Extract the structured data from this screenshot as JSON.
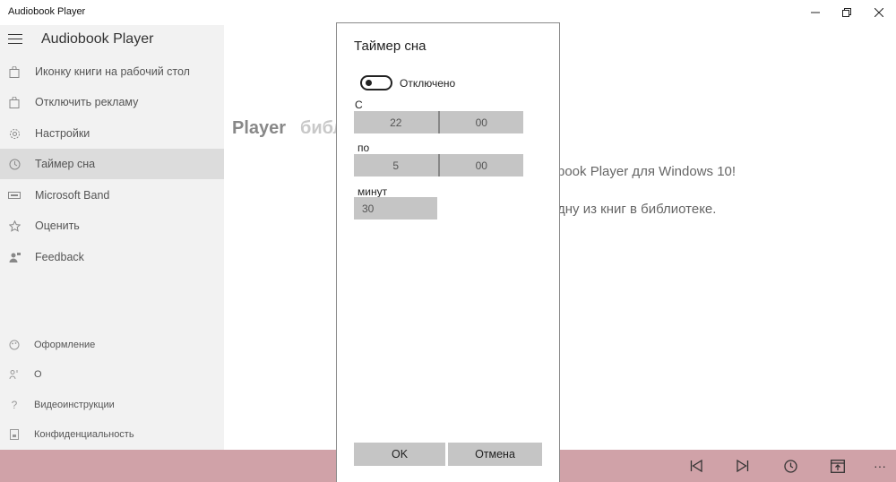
{
  "window": {
    "title": "Audiobook Player",
    "controls": [
      "minimize-icon",
      "restore-icon",
      "close-icon"
    ]
  },
  "sidebar": {
    "title": "Audiobook Player",
    "items": [
      {
        "label": "Иконку книги на рабочий стол",
        "icon": "shopping-bag-icon"
      },
      {
        "label": "Отключить рекламу",
        "icon": "shopping-bag-icon"
      },
      {
        "label": "Настройки",
        "icon": "gear-icon"
      },
      {
        "label": "Таймер сна",
        "icon": "clock-icon",
        "selected": true
      },
      {
        "label": "Microsoft Band",
        "icon": "band-icon"
      },
      {
        "label": "Оценить",
        "icon": "star-icon"
      },
      {
        "label": "Feedback",
        "icon": "feedback-icon"
      }
    ],
    "bottom_items": [
      {
        "label": "Оформление",
        "icon": "palette-icon"
      },
      {
        "label": "О",
        "icon": "about-icon"
      },
      {
        "label": "Видеоинструкции",
        "icon": "help-icon"
      },
      {
        "label": "Конфиденциальность",
        "icon": "privacy-icon"
      }
    ]
  },
  "main": {
    "tabs": [
      "Player",
      "библ"
    ],
    "welcome_line1": "book Player для Windows 10!",
    "welcome_line2": "дну из книг в библиотеке."
  },
  "dialog": {
    "title": "Таймер сна",
    "toggle": {
      "label": "Отключено",
      "on": false
    },
    "from_label": "С",
    "from_hour": "22",
    "from_minute": "00",
    "to_label": "по",
    "to_hour": "5",
    "to_minute": "00",
    "minutes_label": "минут",
    "minutes_value": "30",
    "ok_label": "OK",
    "cancel_label": "Отмена"
  },
  "bottombar": {
    "buttons": [
      "previous-icon",
      "next-icon",
      "timer-icon",
      "bookmark-icon",
      "more-icon"
    ],
    "more_label": "···"
  },
  "colors": {
    "bottombar": "#d0a2a8",
    "sidebar": "#f2f2f2",
    "selected": "#dcdcdc",
    "field": "#c5c5c5"
  }
}
